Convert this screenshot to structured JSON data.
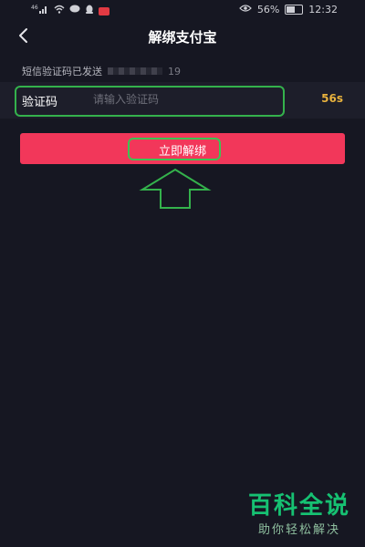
{
  "status_bar": {
    "signal_text": "46",
    "battery_percent": "56%",
    "time": "12:32",
    "icons": [
      "signal-icon",
      "wifi-icon",
      "chat-icon",
      "qq-icon",
      "app-notification-icon",
      "eye-comfort-icon",
      "battery-icon"
    ]
  },
  "nav": {
    "title": "解绑支付宝",
    "back_icon": "chevron-left-icon"
  },
  "sms": {
    "prefix": "短信验证码已发送",
    "suffix": "19"
  },
  "code_field": {
    "label": "验证码",
    "placeholder": "请输入验证码",
    "value": "",
    "countdown": "56s"
  },
  "unbind_button": {
    "label": "立即解绑"
  },
  "annotation": {
    "highlight_color": "#3bc554",
    "arrow_icon": "up-arrow-icon"
  },
  "watermark": {
    "title": "百科全说",
    "subtitle": "助你轻松解决"
  },
  "colors": {
    "background": "#161722",
    "accent": "#f2375a",
    "countdown": "#e8b23d",
    "annotation": "#34b24c",
    "watermark": "#16c172"
  }
}
